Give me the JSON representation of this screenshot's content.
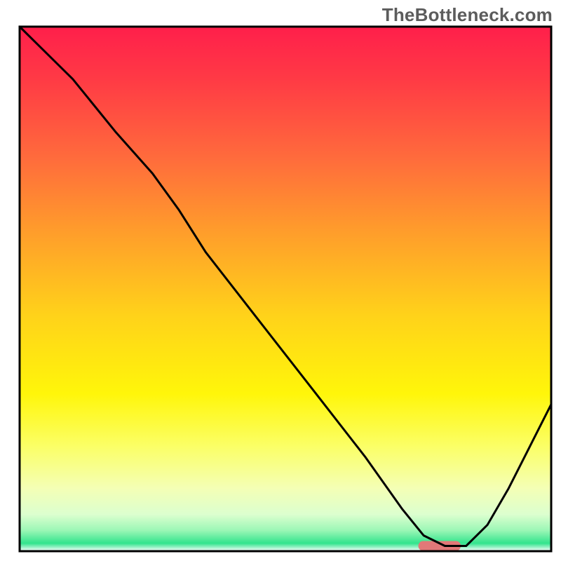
{
  "watermark": "TheBottleneck.com",
  "chart_data": {
    "type": "line",
    "title": "",
    "xlabel": "",
    "ylabel": "",
    "xlim": [
      0,
      100
    ],
    "ylim": [
      0,
      100
    ],
    "x": [
      0,
      3,
      10,
      18,
      25,
      30,
      35,
      45,
      55,
      65,
      72,
      76,
      80,
      84,
      88,
      92,
      96,
      100
    ],
    "values": [
      100,
      97,
      90,
      80,
      72,
      65,
      57,
      44,
      31,
      18,
      8,
      3,
      1,
      1,
      5,
      12,
      20,
      28
    ],
    "marker": {
      "x_start": 75,
      "x_end": 83,
      "y": 1,
      "color": "#e17878"
    },
    "gradient_stops": [
      {
        "offset": 0.0,
        "color": "#ff1f4b"
      },
      {
        "offset": 0.1,
        "color": "#ff3a45"
      },
      {
        "offset": 0.25,
        "color": "#ff6b3c"
      },
      {
        "offset": 0.4,
        "color": "#ffa02a"
      },
      {
        "offset": 0.55,
        "color": "#ffd21a"
      },
      {
        "offset": 0.7,
        "color": "#fff60a"
      },
      {
        "offset": 0.8,
        "color": "#fbff66"
      },
      {
        "offset": 0.88,
        "color": "#f4ffb5"
      },
      {
        "offset": 0.93,
        "color": "#dcffcf"
      },
      {
        "offset": 0.96,
        "color": "#9cf7b6"
      },
      {
        "offset": 0.985,
        "color": "#32e48d"
      },
      {
        "offset": 1.0,
        "color": "#ffffff"
      }
    ],
    "border_color": "#000000",
    "line_color": "#000000"
  }
}
